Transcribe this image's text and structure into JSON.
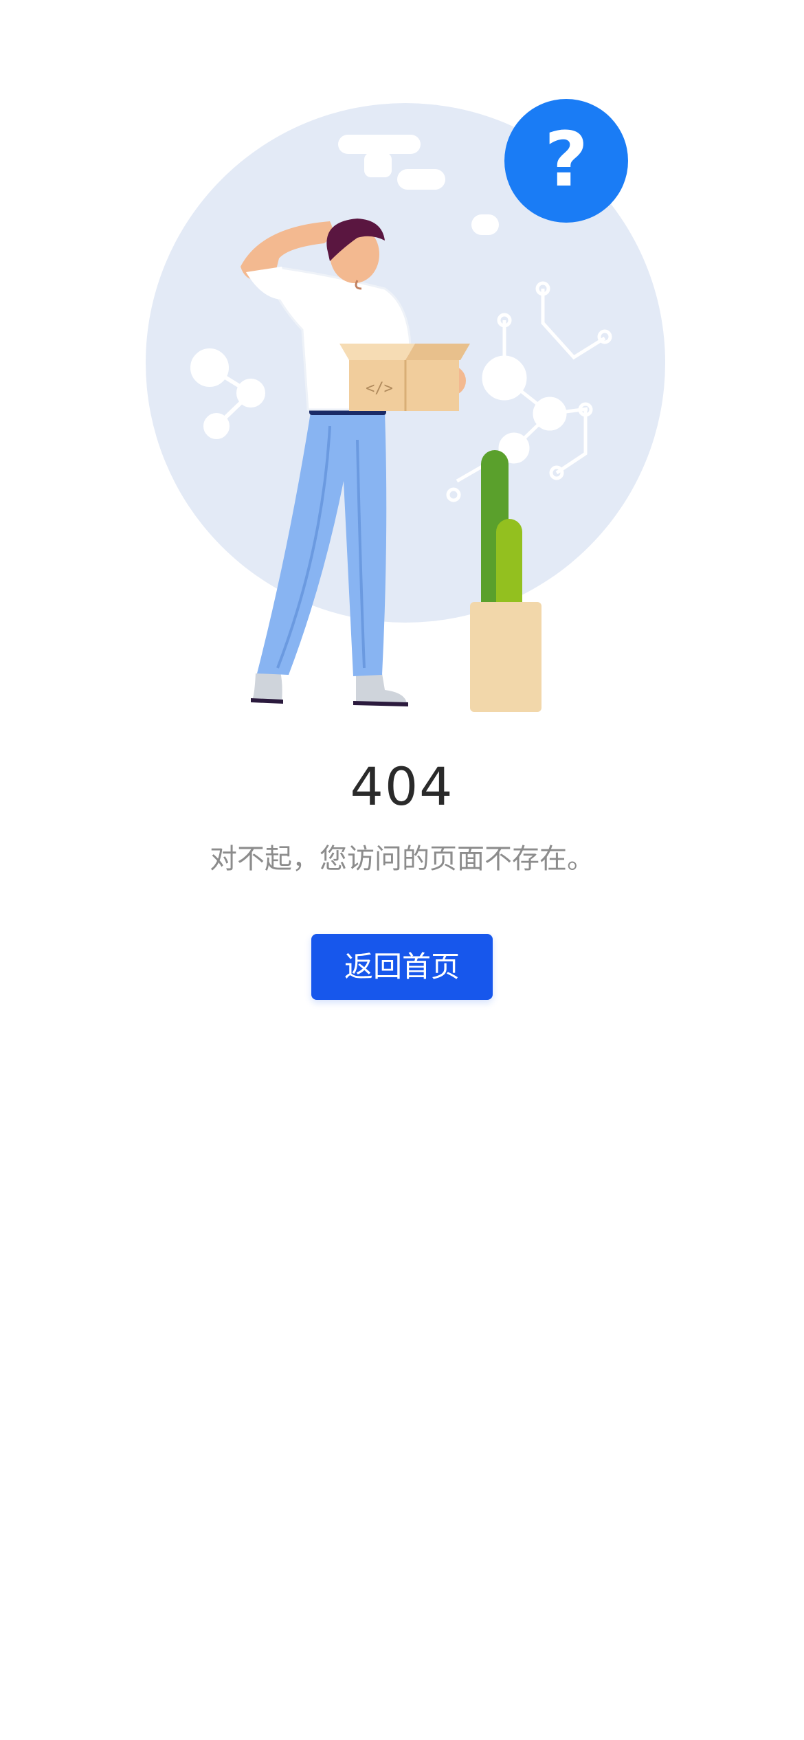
{
  "error": {
    "code": "404",
    "message": "对不起，您访问的页面不存在。"
  },
  "actions": {
    "home_label": "返回首页"
  },
  "illustration": {
    "badge_symbol": "?",
    "box_code_glyph": "</>"
  },
  "colors": {
    "accent": "#1757ec",
    "badge": "#1a7cf5",
    "background_circle": "#e3eaf6",
    "code_text": "#2a2a2a",
    "message_text": "#8c8c8c"
  },
  "icons": {
    "badge": "question-mark-icon"
  }
}
